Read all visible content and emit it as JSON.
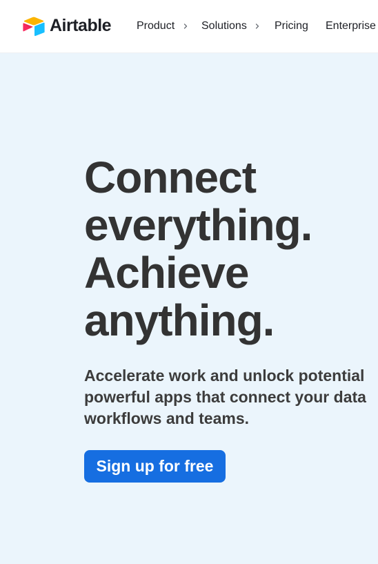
{
  "header": {
    "logo_text": "Airtable",
    "logo_icon": "airtable-logo-icon",
    "nav": [
      {
        "label": "Product",
        "has_submenu": true,
        "icon": "chevron-right-icon"
      },
      {
        "label": "Solutions",
        "has_submenu": true,
        "icon": "chevron-right-icon"
      },
      {
        "label": "Pricing",
        "has_submenu": false
      },
      {
        "label": "Enterprise",
        "has_submenu": false
      }
    ]
  },
  "hero": {
    "headline_lines": [
      "Connect",
      "everything.",
      "Achieve",
      "anything."
    ],
    "subhead_lines": [
      "Accelerate work and unlock potential",
      "powerful apps that connect your data",
      "workflows and teams."
    ],
    "cta_label": "Sign up for free"
  },
  "colors": {
    "hero_background": "#ebf5fc",
    "cta_background": "#166ee1",
    "text_primary": "#333333",
    "logo_yellow": "#fcb400",
    "logo_blue": "#18bfff",
    "logo_red": "#f82b60"
  }
}
